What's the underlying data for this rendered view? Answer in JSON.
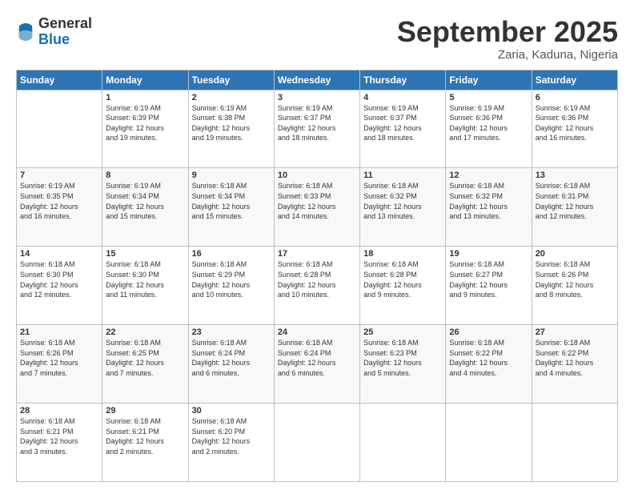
{
  "header": {
    "logo": {
      "general": "General",
      "blue": "Blue"
    },
    "title": "September 2025",
    "subtitle": "Zaria, Kaduna, Nigeria"
  },
  "days_of_week": [
    "Sunday",
    "Monday",
    "Tuesday",
    "Wednesday",
    "Thursday",
    "Friday",
    "Saturday"
  ],
  "weeks": [
    [
      {
        "day": "",
        "sunrise": "",
        "sunset": "",
        "daylight": ""
      },
      {
        "day": "1",
        "sunrise": "Sunrise: 6:19 AM",
        "sunset": "Sunset: 6:39 PM",
        "daylight": "Daylight: 12 hours and 19 minutes."
      },
      {
        "day": "2",
        "sunrise": "Sunrise: 6:19 AM",
        "sunset": "Sunset: 6:38 PM",
        "daylight": "Daylight: 12 hours and 19 minutes."
      },
      {
        "day": "3",
        "sunrise": "Sunrise: 6:19 AM",
        "sunset": "Sunset: 6:37 PM",
        "daylight": "Daylight: 12 hours and 18 minutes."
      },
      {
        "day": "4",
        "sunrise": "Sunrise: 6:19 AM",
        "sunset": "Sunset: 6:37 PM",
        "daylight": "Daylight: 12 hours and 18 minutes."
      },
      {
        "day": "5",
        "sunrise": "Sunrise: 6:19 AM",
        "sunset": "Sunset: 6:36 PM",
        "daylight": "Daylight: 12 hours and 17 minutes."
      },
      {
        "day": "6",
        "sunrise": "Sunrise: 6:19 AM",
        "sunset": "Sunset: 6:36 PM",
        "daylight": "Daylight: 12 hours and 16 minutes."
      }
    ],
    [
      {
        "day": "7",
        "sunrise": "Sunrise: 6:19 AM",
        "sunset": "Sunset: 6:35 PM",
        "daylight": "Daylight: 12 hours and 16 minutes."
      },
      {
        "day": "8",
        "sunrise": "Sunrise: 6:19 AM",
        "sunset": "Sunset: 6:34 PM",
        "daylight": "Daylight: 12 hours and 15 minutes."
      },
      {
        "day": "9",
        "sunrise": "Sunrise: 6:18 AM",
        "sunset": "Sunset: 6:34 PM",
        "daylight": "Daylight: 12 hours and 15 minutes."
      },
      {
        "day": "10",
        "sunrise": "Sunrise: 6:18 AM",
        "sunset": "Sunset: 6:33 PM",
        "daylight": "Daylight: 12 hours and 14 minutes."
      },
      {
        "day": "11",
        "sunrise": "Sunrise: 6:18 AM",
        "sunset": "Sunset: 6:32 PM",
        "daylight": "Daylight: 12 hours and 13 minutes."
      },
      {
        "day": "12",
        "sunrise": "Sunrise: 6:18 AM",
        "sunset": "Sunset: 6:32 PM",
        "daylight": "Daylight: 12 hours and 13 minutes."
      },
      {
        "day": "13",
        "sunrise": "Sunrise: 6:18 AM",
        "sunset": "Sunset: 6:31 PM",
        "daylight": "Daylight: 12 hours and 12 minutes."
      }
    ],
    [
      {
        "day": "14",
        "sunrise": "Sunrise: 6:18 AM",
        "sunset": "Sunset: 6:30 PM",
        "daylight": "Daylight: 12 hours and 12 minutes."
      },
      {
        "day": "15",
        "sunrise": "Sunrise: 6:18 AM",
        "sunset": "Sunset: 6:30 PM",
        "daylight": "Daylight: 12 hours and 11 minutes."
      },
      {
        "day": "16",
        "sunrise": "Sunrise: 6:18 AM",
        "sunset": "Sunset: 6:29 PM",
        "daylight": "Daylight: 12 hours and 10 minutes."
      },
      {
        "day": "17",
        "sunrise": "Sunrise: 6:18 AM",
        "sunset": "Sunset: 6:28 PM",
        "daylight": "Daylight: 12 hours and 10 minutes."
      },
      {
        "day": "18",
        "sunrise": "Sunrise: 6:18 AM",
        "sunset": "Sunset: 6:28 PM",
        "daylight": "Daylight: 12 hours and 9 minutes."
      },
      {
        "day": "19",
        "sunrise": "Sunrise: 6:18 AM",
        "sunset": "Sunset: 6:27 PM",
        "daylight": "Daylight: 12 hours and 9 minutes."
      },
      {
        "day": "20",
        "sunrise": "Sunrise: 6:18 AM",
        "sunset": "Sunset: 6:26 PM",
        "daylight": "Daylight: 12 hours and 8 minutes."
      }
    ],
    [
      {
        "day": "21",
        "sunrise": "Sunrise: 6:18 AM",
        "sunset": "Sunset: 6:26 PM",
        "daylight": "Daylight: 12 hours and 7 minutes."
      },
      {
        "day": "22",
        "sunrise": "Sunrise: 6:18 AM",
        "sunset": "Sunset: 6:25 PM",
        "daylight": "Daylight: 12 hours and 7 minutes."
      },
      {
        "day": "23",
        "sunrise": "Sunrise: 6:18 AM",
        "sunset": "Sunset: 6:24 PM",
        "daylight": "Daylight: 12 hours and 6 minutes."
      },
      {
        "day": "24",
        "sunrise": "Sunrise: 6:18 AM",
        "sunset": "Sunset: 6:24 PM",
        "daylight": "Daylight: 12 hours and 6 minutes."
      },
      {
        "day": "25",
        "sunrise": "Sunrise: 6:18 AM",
        "sunset": "Sunset: 6:23 PM",
        "daylight": "Daylight: 12 hours and 5 minutes."
      },
      {
        "day": "26",
        "sunrise": "Sunrise: 6:18 AM",
        "sunset": "Sunset: 6:22 PM",
        "daylight": "Daylight: 12 hours and 4 minutes."
      },
      {
        "day": "27",
        "sunrise": "Sunrise: 6:18 AM",
        "sunset": "Sunset: 6:22 PM",
        "daylight": "Daylight: 12 hours and 4 minutes."
      }
    ],
    [
      {
        "day": "28",
        "sunrise": "Sunrise: 6:18 AM",
        "sunset": "Sunset: 6:21 PM",
        "daylight": "Daylight: 12 hours and 3 minutes."
      },
      {
        "day": "29",
        "sunrise": "Sunrise: 6:18 AM",
        "sunset": "Sunset: 6:21 PM",
        "daylight": "Daylight: 12 hours and 2 minutes."
      },
      {
        "day": "30",
        "sunrise": "Sunrise: 6:18 AM",
        "sunset": "Sunset: 6:20 PM",
        "daylight": "Daylight: 12 hours and 2 minutes."
      },
      {
        "day": "",
        "sunrise": "",
        "sunset": "",
        "daylight": ""
      },
      {
        "day": "",
        "sunrise": "",
        "sunset": "",
        "daylight": ""
      },
      {
        "day": "",
        "sunrise": "",
        "sunset": "",
        "daylight": ""
      },
      {
        "day": "",
        "sunrise": "",
        "sunset": "",
        "daylight": ""
      }
    ]
  ]
}
